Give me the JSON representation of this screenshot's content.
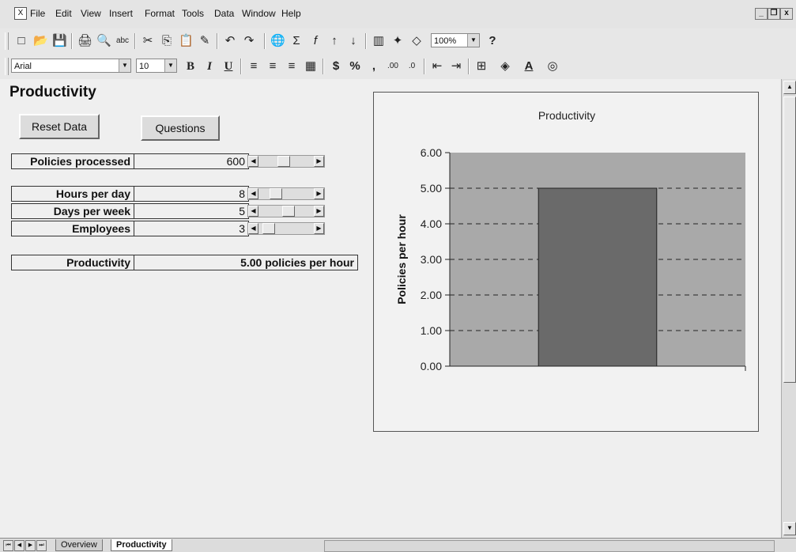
{
  "menu": {
    "doc_icon": "doc-icon",
    "items": [
      "File",
      "Edit",
      "View",
      "Insert",
      "Format",
      "Tools",
      "Data",
      "Window",
      "Help"
    ],
    "mnemonic": [
      "F",
      "E",
      "V",
      "I",
      "o",
      "T",
      "D",
      "W",
      "H"
    ],
    "window_controls": [
      "_",
      "❐",
      "x"
    ]
  },
  "toolbar1": {
    "icons": [
      "□",
      "📂",
      "💾",
      "🖨",
      "🔍",
      "abc",
      "✂",
      "⎘",
      "📋",
      "✎",
      "↶",
      "↷",
      "🌐",
      "Σ",
      "f",
      "↑",
      "↓",
      "▥",
      "✦",
      "◇"
    ],
    "zoom": "100%",
    "help_icon": "?"
  },
  "toolbar2": {
    "font": "Arial",
    "size": "10",
    "bold": "B",
    "italic": "I",
    "underline": "U",
    "currency": "$",
    "percent": "%",
    "comma": ",",
    "inc_decimal": ".00",
    "dec_decimal": ".0"
  },
  "sheet": {
    "title": "Productivity",
    "reset_button": "Reset Data",
    "questions_button": "Questions",
    "rows": [
      {
        "label": "Policies processed",
        "value": "600",
        "thumb": 0.45
      },
      {
        "label": "Hours per day",
        "value": "8",
        "thumb": 0.25
      },
      {
        "label": "Days per week",
        "value": "5",
        "thumb": 0.55
      },
      {
        "label": "Employees",
        "value": "3",
        "thumb": 0.1
      }
    ],
    "result_label": "Productivity",
    "result_value": "5.00 policies per hour"
  },
  "chart_data": {
    "type": "bar",
    "title": "Productivity",
    "xlabel": "",
    "ylabel": "Policies per hour",
    "categories": [
      ""
    ],
    "values": [
      5.0
    ],
    "ylim": [
      0,
      6
    ],
    "yticks": [
      "0.00",
      "1.00",
      "2.00",
      "3.00",
      "4.00",
      "5.00",
      "6.00"
    ],
    "grid": true,
    "colors": {
      "plot_bg": "#a9a9a9",
      "bar": "#6a6a6a",
      "grid": "#222222"
    }
  },
  "tabs": {
    "nav": [
      "⏮",
      "◀",
      "▶",
      "⏭"
    ],
    "items": [
      "Overview",
      "Productivity"
    ],
    "active": "Productivity"
  }
}
